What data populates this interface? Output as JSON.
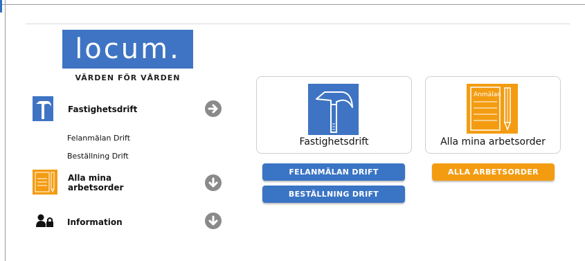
{
  "logo": {
    "text": "locum.",
    "tagline": "VÄRDEN FÖR VÅRDEN",
    "color": "#3e74c3"
  },
  "sidebar": {
    "fastighetsdrift": {
      "label": "Fastighetsdrift",
      "icon": "hammer-icon",
      "links": [
        "Felanmälan Drift",
        "Beställning Drift"
      ]
    },
    "arbetsorder": {
      "label": "Alla mina arbetsorder",
      "icon": "form-pencil-icon"
    },
    "information": {
      "label": "Information",
      "icon": "users-lock-icon"
    }
  },
  "cards": [
    {
      "label": "Fastighetsdrift",
      "icon": "hammer-icon",
      "color": "#3e74c3"
    },
    {
      "label": "Alla mina arbetsorder",
      "icon": "form-pencil-icon",
      "color": "#f39c12",
      "icon_text": "Anmälan"
    }
  ],
  "buttons": {
    "felanmalan": "FELANMÄLAN DRIFT",
    "bestallning": "BESTÄLLNING DRIFT",
    "arbetsorder": "ALLA ARBETSORDER"
  },
  "colors": {
    "blue": "#3a74c4",
    "orange": "#f39c12",
    "gray": "#8a8a8a"
  }
}
